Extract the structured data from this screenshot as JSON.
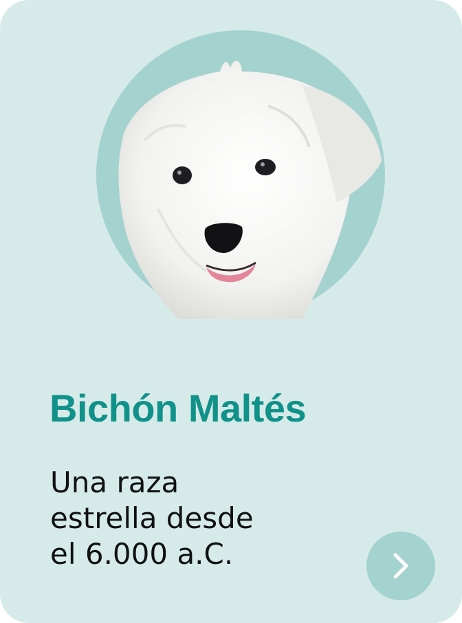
{
  "breed": {
    "name": "Bichón Maltés",
    "description_lines": [
      "Una raza",
      "estrella desde",
      "el 6.000 a.C."
    ]
  },
  "image": {
    "icon": "maltese-dog-photo"
  },
  "next_button": {
    "icon": "chevron-right-icon"
  },
  "colors": {
    "card_background": "#d6ebe9",
    "portrait_circle": "#a4d2cf",
    "title": "#109189",
    "button_background": "#a4d2cf",
    "button_icon": "#ffffff",
    "text": "#111111"
  }
}
